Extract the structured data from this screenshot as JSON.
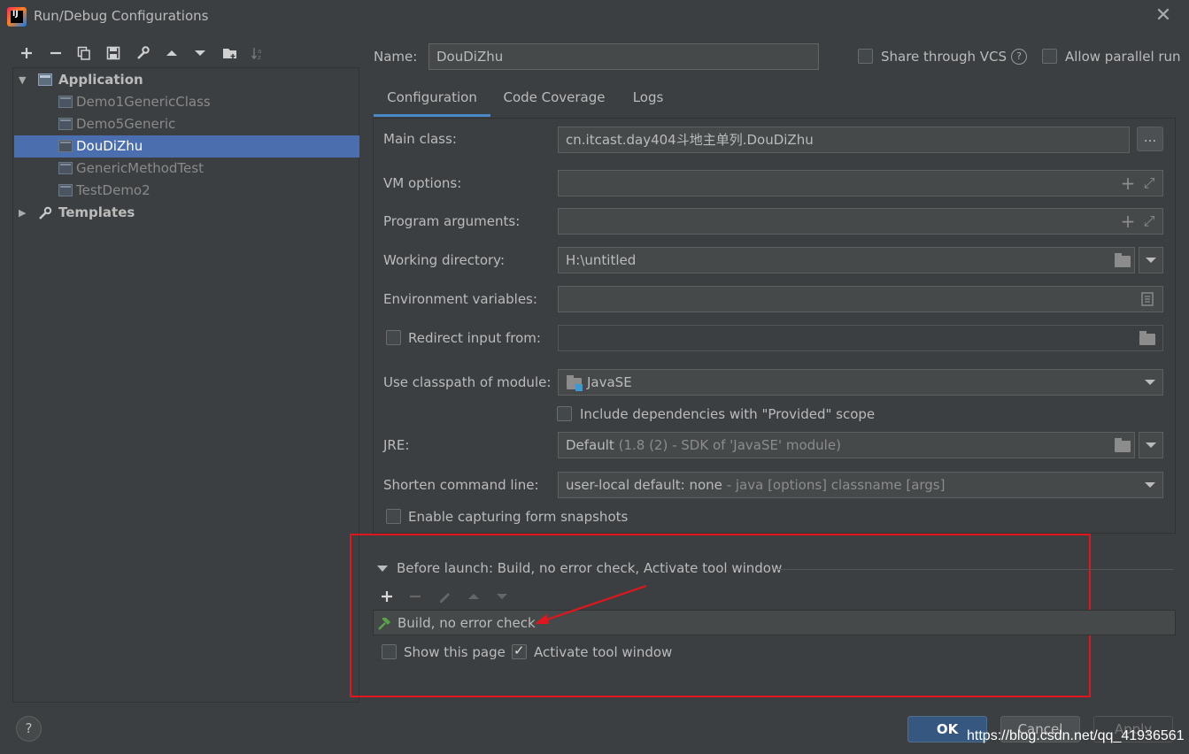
{
  "window": {
    "title": "Run/Debug Configurations",
    "app_icon": "intellij-idea-icon",
    "close_icon": "close-icon"
  },
  "toolbar": {
    "icons": [
      "add-icon",
      "remove-icon",
      "copy-icon",
      "save-icon",
      "wrench-icon",
      "move-up-icon",
      "move-down-icon",
      "new-folder-icon",
      "sort-alpha-icon"
    ]
  },
  "tree": {
    "application": {
      "label": "Application",
      "expanded": true
    },
    "configs": [
      "Demo1GenericClass",
      "Demo5Generic",
      "DouDiZhu",
      "GenericMethodTest",
      "TestDemo2"
    ],
    "selected": "DouDiZhu",
    "templates": {
      "label": "Templates",
      "expanded": false
    }
  },
  "header": {
    "name_label": "Name:",
    "name_value": "DouDiZhu",
    "share_vcs_label": "Share through VCS",
    "share_vcs_checked": false,
    "help_glyph": "?",
    "parallel_label": "Allow parallel run",
    "parallel_checked": false
  },
  "tabs": [
    {
      "label": "Configuration",
      "active": true
    },
    {
      "label": "Code Coverage",
      "active": false
    },
    {
      "label": "Logs",
      "active": false
    }
  ],
  "form": {
    "main_class_label": "Main class:",
    "main_class_value": "cn.itcast.day404斗地主单列.DouDiZhu",
    "browse_label": "...",
    "vm_options_label": "VM options:",
    "vm_options_value": "",
    "program_args_label": "Program arguments:",
    "program_args_value": "",
    "working_dir_label": "Working directory:",
    "working_dir_value": "H:\\untitled",
    "env_vars_label": "Environment variables:",
    "env_vars_value": "",
    "redirect_label": "Redirect input from:",
    "redirect_checked": false,
    "redirect_value": "",
    "module_label": "Use classpath of module:",
    "module_value": "JavaSE",
    "include_deps_label": "Include dependencies with \"Provided\" scope",
    "include_deps_checked": false,
    "jre_label": "JRE:",
    "jre_value": "Default",
    "jre_detail": "(1.8 (2) - SDK of 'JavaSE' module)",
    "shorten_label": "Shorten command line:",
    "shorten_value": "user-local default: none",
    "shorten_detail": "- java [options] classname [args]",
    "capture_label": "Enable capturing form snapshots",
    "capture_checked": false
  },
  "before_launch": {
    "header": "Before launch: Build, no error check, Activate tool window",
    "task": "Build, no error check",
    "task_icon": "hammer-icon",
    "show_page_label": "Show this page",
    "show_page_checked": false,
    "activate_label": "Activate tool window",
    "activate_checked": true,
    "annotation_color": "#e0161c"
  },
  "footer": {
    "help_label": "?",
    "ok_label": "OK",
    "cancel_label": "Cancel",
    "apply_label": "Apply",
    "watermark": "https://blog.csdn.net/qq_41936561"
  },
  "colors": {
    "background": "#3c3f41",
    "selection": "#4b6eaf",
    "accent": "#4a88c7",
    "ok_button": "#365880"
  }
}
